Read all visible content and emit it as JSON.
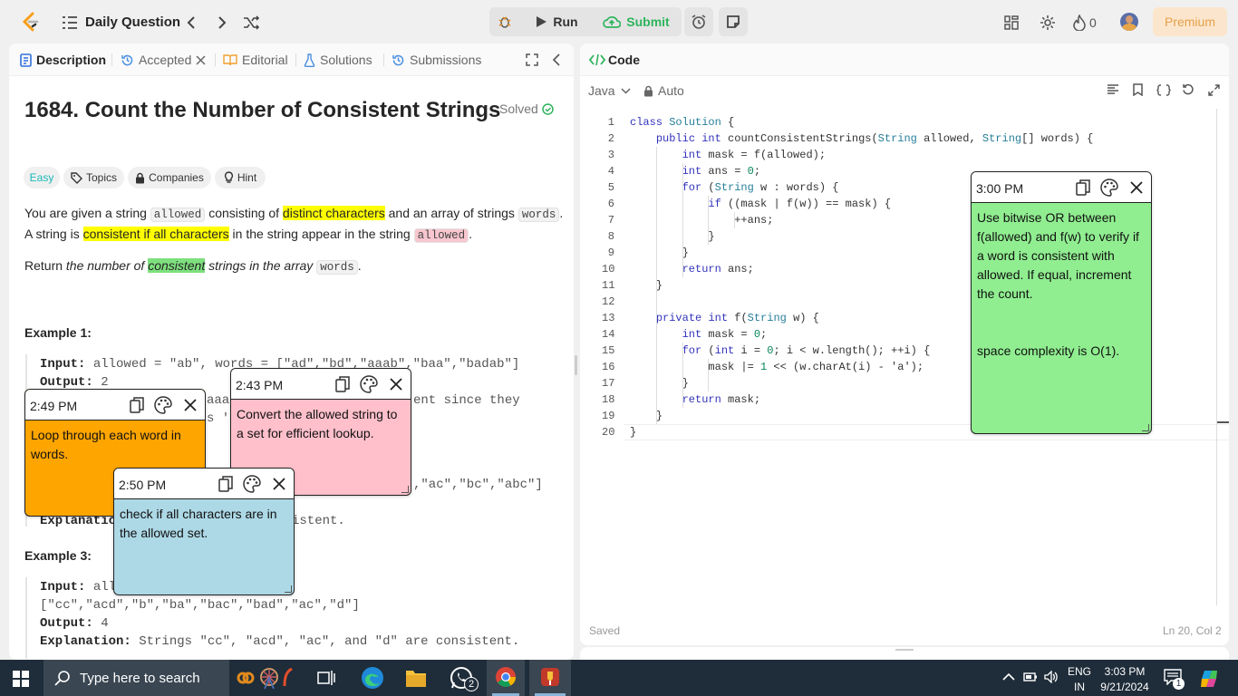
{
  "topbar": {
    "title": "Daily Question",
    "run_label": "Run",
    "submit_label": "Submit",
    "streak_count": "0",
    "premium_label": "Premium"
  },
  "left_tabs": [
    {
      "label": "Description",
      "icon": "description-icon"
    },
    {
      "label": "Accepted",
      "icon": "history-icon"
    },
    {
      "label": "Editorial",
      "icon": "book-icon"
    },
    {
      "label": "Solutions",
      "icon": "flask-icon"
    },
    {
      "label": "Submissions",
      "icon": "history-icon"
    }
  ],
  "problem": {
    "title": "1684. Count the Number of Consistent Strings",
    "status": "Solved",
    "chips": [
      "Easy",
      "Topics",
      "Companies",
      "Hint"
    ],
    "p1_a": "You are given a string ",
    "p1_code1": "allowed",
    "p1_b": " consisting of ",
    "p1_hl1": "distinct characters",
    "p1_c": " and an array of strings ",
    "p1_code2": "words",
    "p1_d": ".",
    "p2_a": "A string is ",
    "p2_hl": "consistent if all characters",
    "p2_b": " in the string appear in the string ",
    "p2_code": "allowed",
    "p2_c": ".",
    "p3_a": "Return ",
    "p3_i1": "the number of ",
    "p3_hl": "consistent",
    "p3_i2": " strings in the array ",
    "p3_code": "words",
    "p3_c": ".",
    "example1": "Example 1:",
    "ex1_input_label": "Input:",
    "ex1_input_value": " allowed = \"ab\", words = [\"ad\",\"bd\",\"aaab\",\"baa\",\"badab\"]",
    "ex1_output_label": "Output:",
    "ex1_output_value": " 2",
    "ex1_partial1": "aaa",
    "ex1_partial2": "ent since they",
    "ex1_partial3": "s '",
    "ex2_partial": ",\"ac\",\"bc\",\"abc\"]",
    "ex2_expl_label": "Explanatic",
    "ex2_expl_partial": "istent.",
    "example3": "Example 3:",
    "ex3_input_label": "Input:",
    "ex3_input_partial": " all",
    "ex3_input_line2": "[\"cc\",\"acd\",\"b\",\"ba\",\"bac\",\"bad\",\"ac\",\"d\"]",
    "ex3_output_label": "Output:",
    "ex3_output_value": " 4",
    "ex3_expl_label": "Explanation:",
    "ex3_expl_value": " Strings \"cc\", \"acd\", \"ac\", and \"d\" are consistent."
  },
  "code_panel": {
    "title": "Code",
    "language": "Java",
    "mode": "Auto",
    "status": "Saved",
    "cursor": "Ln 20, Col 2"
  },
  "code_lines": [
    "class Solution {",
    "    public int countConsistentStrings(String allowed, String[] words) {",
    "        int mask = f(allowed);",
    "        int ans = 0;",
    "        for (String w : words) {",
    "            if ((mask | f(w)) == mask) {",
    "                ++ans;",
    "            }",
    "        }",
    "        return ans;",
    "    }",
    "",
    "    private int f(String w) {",
    "        int mask = 0;",
    "        for (int i = 0; i < w.length(); ++i) {",
    "            mask |= 1 << (w.charAt(i) - 'a');",
    "        }",
    "        return mask;",
    "    }",
    "}"
  ],
  "notes": [
    {
      "time": "2:49 PM",
      "text": "Loop through each word in words.",
      "color": "#ffa500"
    },
    {
      "time": "2:43 PM",
      "text": "Convert the allowed string to a set for efficient lookup.",
      "color": "#ffc0cb"
    },
    {
      "time": "2:50 PM",
      "text": "check if all characters are in the allowed set.",
      "color": "#add8e6"
    },
    {
      "time": "3:00 PM",
      "text": "Use bitwise OR between f(allowed) and f(w) to verify if a word is consistent with allowed. If equal, increment the count.\n\n\nspace complexity is O(1).",
      "color": "#90ee90"
    }
  ],
  "taskbar": {
    "search_placeholder": "Type here to search",
    "whatsapp_badge": "2",
    "lang_line1": "ENG",
    "lang_line2": "IN",
    "time": "3:03 PM",
    "date": "9/21/2024",
    "notif_count": "1"
  }
}
